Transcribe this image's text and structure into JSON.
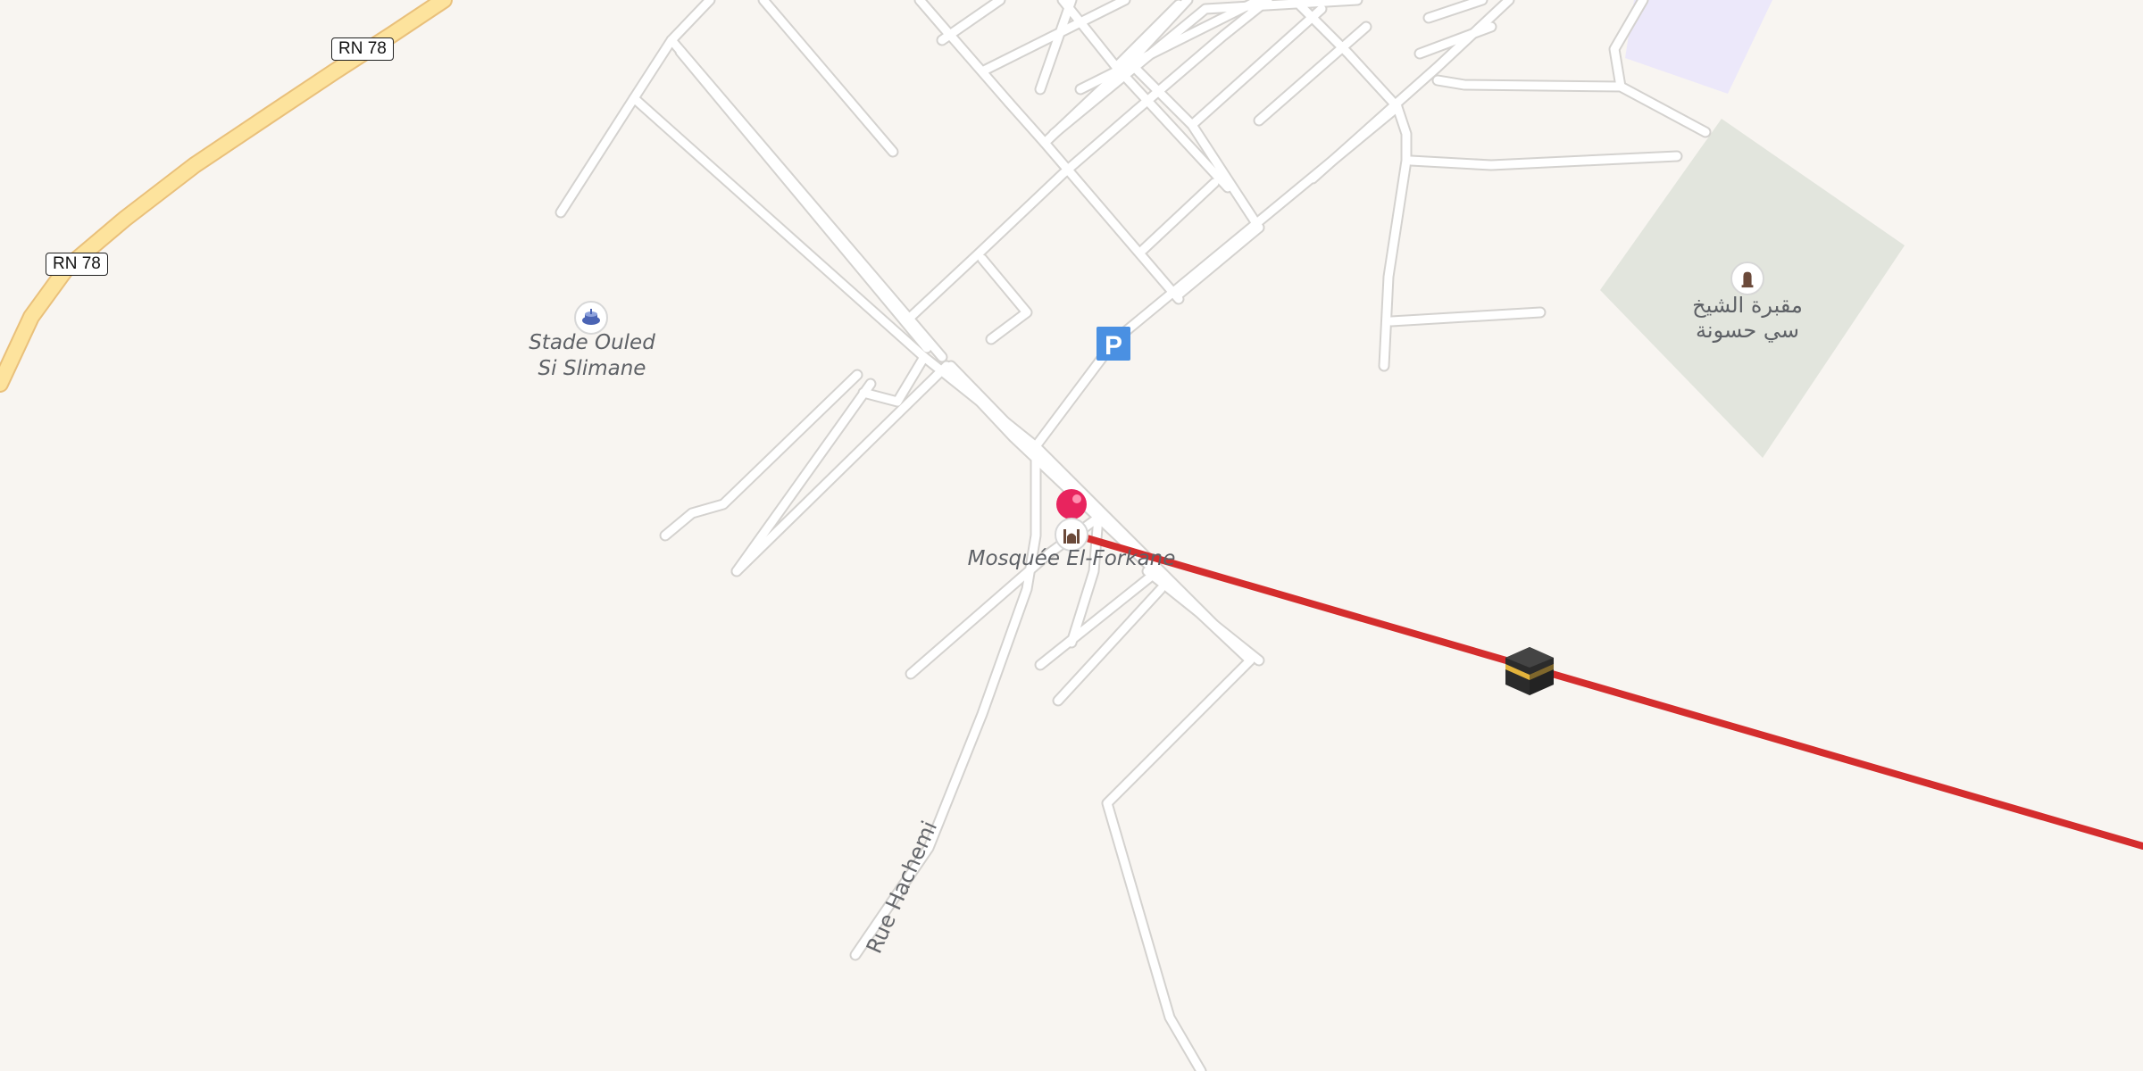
{
  "map": {
    "road_shields": [
      {
        "id": "rn78-top",
        "text": "RN 78"
      },
      {
        "id": "rn78-left",
        "text": "RN 78"
      }
    ],
    "places": {
      "stadium": {
        "name_line1": "Stade Ouled",
        "name_line2": "Si Slimane",
        "icon": "stadium-icon"
      },
      "mosque": {
        "name": "Mosquée El-Forkane",
        "icon": "mosque-icon"
      },
      "cemetery": {
        "name_line1": "مقبرة الشيخ",
        "name_line2": "سي حسونة",
        "icon": "cemetery-icon"
      },
      "parking": {
        "label": "P",
        "icon": "parking-icon"
      }
    },
    "street_labels": {
      "rue_hachemi": "Rue Hachemi"
    },
    "markers": {
      "location_pin": "location-pin-icon",
      "kaaba": "kaaba-icon"
    },
    "colors": {
      "background": "#f8f5f1",
      "road": "#ffffff",
      "road_casing": "#d4d2cf",
      "highway": "#fde39d",
      "highway_casing": "#e9c07b",
      "qibla_line": "#d42d2d",
      "pin": "#e8245e",
      "parking": "#4a90e2",
      "cemetery_area": "#e2e5dd",
      "lavender_area": "#ece8fa"
    }
  }
}
